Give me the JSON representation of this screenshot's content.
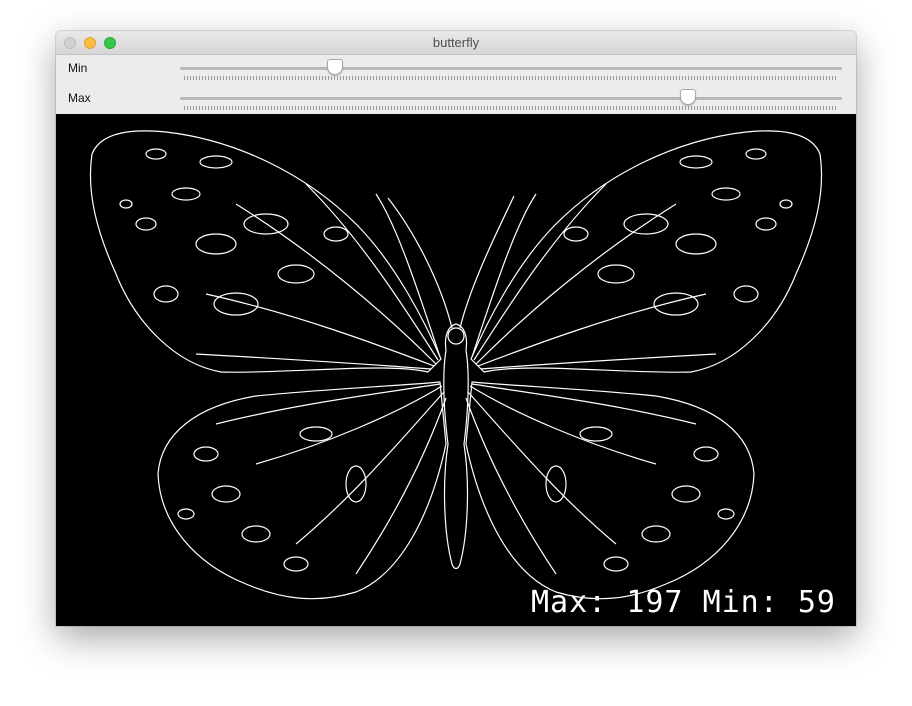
{
  "window": {
    "title": "butterfly"
  },
  "sliders": [
    {
      "label": "Min",
      "value": 59,
      "max": 255
    },
    {
      "label": "Max",
      "value": 197,
      "max": 255
    }
  ],
  "overlay": {
    "max_label": "Max:",
    "max_value": "197",
    "min_label": "Min:",
    "min_value": "59"
  },
  "colors": {
    "canvas": "#000000",
    "edges": "#ffffff"
  }
}
